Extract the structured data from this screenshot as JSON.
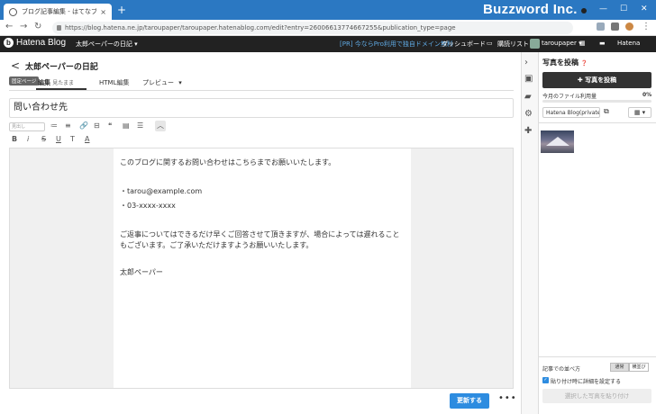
{
  "browser": {
    "tab_title": "ブログ記事編集 - はてなブログ",
    "tab_close": "×",
    "new_tab": "+",
    "brand": "Buzzword Inc.",
    "window_controls": [
      "—",
      "☐",
      "✕"
    ],
    "url": "https://blog.hatena.ne.jp/taroupaper/taroupaper.hatenablog.com/edit?entry=26006613774667255&publication_type=page"
  },
  "hatena_bar": {
    "logo": "Hatena Blog",
    "blog_name": "太郎ペーパーの日記 ▾",
    "promo": "[PR] 今ならPro利用で独自ドメイン無料",
    "dashboard": "ダッシュボード",
    "reading_list": "購読リスト",
    "user": "taroupaper ▾",
    "hatena": "Hatena"
  },
  "editor": {
    "back": "<",
    "blog_title": "太郎ペーパーの日記",
    "page_badge": "固定ページ",
    "tab_edit": "編集",
    "tab_edit_sub": "見たまま",
    "tab_html": "HTML編集",
    "tab_preview": "プレビュー",
    "preview_chevron": "▾",
    "title_value": "問い合わせ先",
    "heading_select": "見出し",
    "collapse": "︿",
    "body": [
      "このブログに関するお問い合わせはこちらまでお願いいたします。",
      "・tarou@example.com",
      "・03-xxxx-xxxx",
      "ご返事についてはできるだけ早くご回答させて頂きますが、場合によっては遅れること",
      "もございます。ご了承いただけますようお願いいたします。",
      "太郎ペーパー"
    ],
    "update_button": "更新する",
    "more": "•••"
  },
  "toolbar": {
    "row1": [
      "≔",
      "≡",
      "🔗",
      "⊟",
      "❝",
      "▤",
      "☰"
    ],
    "row2": [
      "B",
      "i",
      "S",
      "U",
      "T",
      "A"
    ]
  },
  "rail": {
    "icons": [
      "›",
      "▣",
      "▰",
      "⚙",
      "✚"
    ]
  },
  "photo_panel": {
    "title": "写真を投稿",
    "help": "❓",
    "post_button": "✚ 写真を投稿",
    "usage_label": "今月のファイル利用量",
    "usage_value": "0%",
    "usage_fraction": 0.0,
    "album": "Hatena Blog(private) ▾",
    "external_link": "⧉",
    "grid_button": "▦ ▾",
    "sort_label": "記事での並べ方",
    "sort_options": [
      "通常",
      "横並び"
    ],
    "option_checkbox": "貼り付け時に詳細を設定する",
    "paste_button": "選択した写真を貼り付け"
  }
}
